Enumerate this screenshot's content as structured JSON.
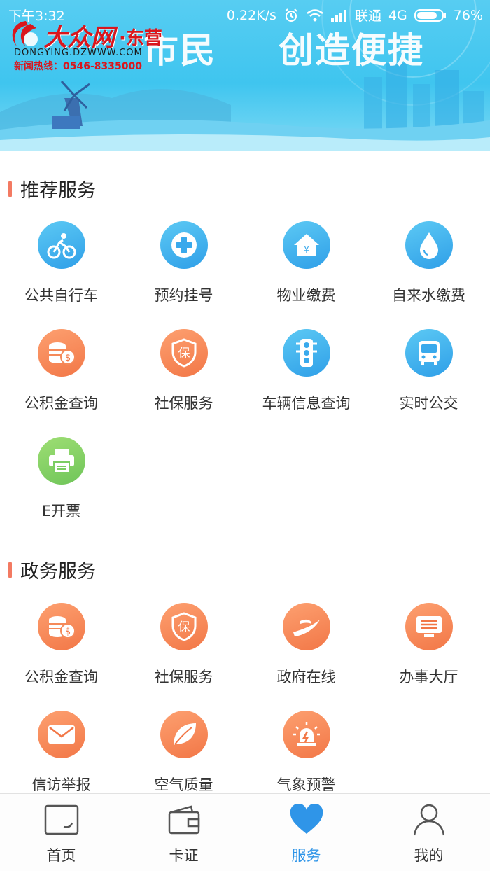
{
  "status_bar": {
    "time": "下午3:32",
    "speed": "0.22K/s",
    "carrier": "联通",
    "network": "4G",
    "battery": "76%",
    "icons": [
      "alarm-icon",
      "wifi-icon",
      "signal-icon",
      "battery-icon"
    ]
  },
  "banner": {
    "slogan_left": "市民",
    "slogan_right": "创造便捷",
    "logo": {
      "name": "大众网",
      "city": "·东营",
      "domain": "DONGYING.DZWWW.COM",
      "hotline": "新闻热线：0546-8335000"
    }
  },
  "sections": [
    {
      "title": "推荐服务",
      "items": [
        {
          "label": "公共自行车",
          "icon": "bicycle-icon",
          "color": "blue"
        },
        {
          "label": "预约挂号",
          "icon": "medical-cross-icon",
          "color": "blue"
        },
        {
          "label": "物业缴费",
          "icon": "house-yen-icon",
          "color": "blue"
        },
        {
          "label": "自来水缴费",
          "icon": "water-drop-icon",
          "color": "blue"
        },
        {
          "label": "公积金查询",
          "icon": "coins-icon",
          "color": "orange"
        },
        {
          "label": "社保服务",
          "icon": "shield-bao-icon",
          "color": "orange"
        },
        {
          "label": "车辆信息查询",
          "icon": "traffic-light-icon",
          "color": "blue"
        },
        {
          "label": "实时公交",
          "icon": "bus-icon",
          "color": "blue"
        },
        {
          "label": "E开票",
          "icon": "printer-icon",
          "color": "green"
        }
      ]
    },
    {
      "title": "政务服务",
      "items": [
        {
          "label": "公积金查询",
          "icon": "coins-icon",
          "color": "orange"
        },
        {
          "label": "社保服务",
          "icon": "shield-bao-icon",
          "color": "orange"
        },
        {
          "label": "政府在线",
          "icon": "swoosh-icon",
          "color": "orange"
        },
        {
          "label": "办事大厅",
          "icon": "monitor-list-icon",
          "color": "orange"
        },
        {
          "label": "信访举报",
          "icon": "envelope-icon",
          "color": "orange"
        },
        {
          "label": "空气质量",
          "icon": "leaf-icon",
          "color": "orange"
        },
        {
          "label": "气象预警",
          "icon": "alarm-light-icon",
          "color": "orange"
        }
      ]
    }
  ],
  "tabbar": {
    "active": "服务",
    "items": [
      {
        "label": "首页",
        "icon": "home-card-icon"
      },
      {
        "label": "卡证",
        "icon": "wallet-icon"
      },
      {
        "label": "服务",
        "icon": "heart-icon"
      },
      {
        "label": "我的",
        "icon": "person-icon"
      }
    ]
  }
}
